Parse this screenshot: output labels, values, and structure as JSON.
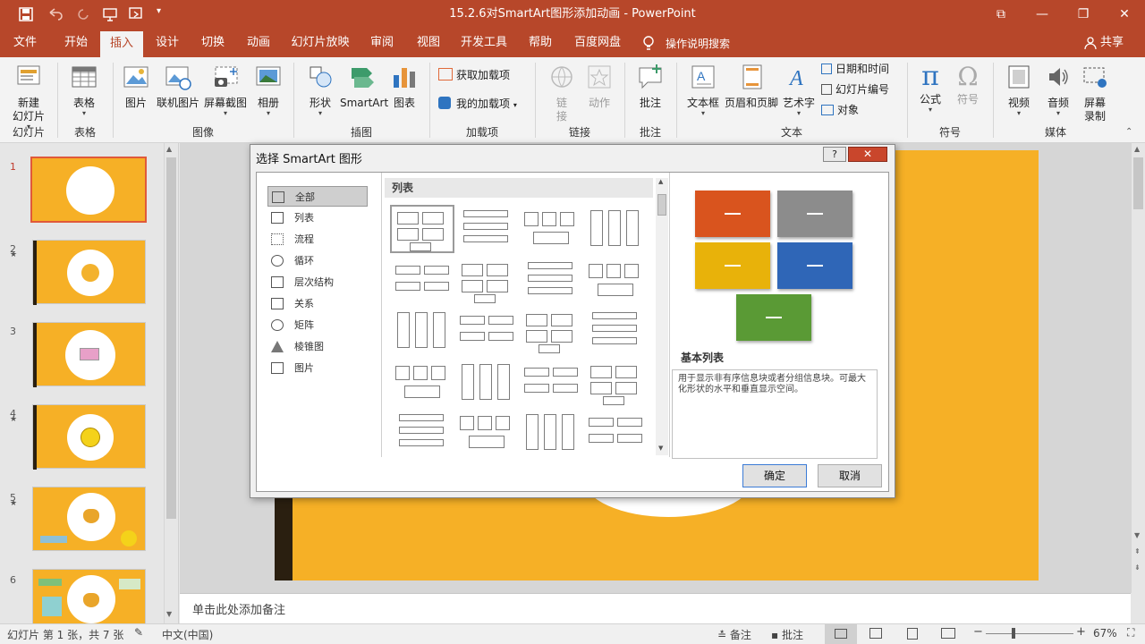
{
  "window": {
    "title": "15.2.6对SmartArt图形添加动画 - PowerPoint"
  },
  "tabs": [
    "文件",
    "开始",
    "插入",
    "设计",
    "切换",
    "动画",
    "幻灯片放映",
    "审阅",
    "视图",
    "开发工具",
    "帮助",
    "百度网盘"
  ],
  "active_tab": "插入",
  "tellme": "操作说明搜索",
  "share": "共享",
  "ribbon": {
    "new_slide": "新建\n幻灯片",
    "table": "表格",
    "picture": "图片",
    "online_picture": "联机图片",
    "screenshot": "屏幕截图",
    "album": "相册",
    "shapes": "形状",
    "smartart": "SmartArt",
    "chart": "图表",
    "get_addins": "获取加载项",
    "my_addins": "我的加载项",
    "link": "链\n接",
    "action": "动作",
    "comment": "批注",
    "textbox": "文本框",
    "header_footer": "页眉和页脚",
    "wordart": "艺术字",
    "datetime": "日期和时间",
    "slide_number": "幻灯片编号",
    "object": "对象",
    "equation": "公式",
    "symbol": "符号",
    "video": "视频",
    "audio": "音频",
    "screen_record": "屏幕\n录制",
    "groups": {
      "slides": "幻灯片",
      "tables": "表格",
      "images": "图像",
      "illustrations": "插图",
      "addins": "加载项",
      "links": "链接",
      "comments": "批注",
      "text": "文本",
      "symbols": "符号",
      "media": "媒体"
    }
  },
  "slides": {
    "numbers": [
      "1",
      "2",
      "3",
      "4",
      "5",
      "6"
    ],
    "selected": 1
  },
  "notes_placeholder": "单击此处添加备注",
  "status": {
    "slide_info": "幻灯片 第 1 张，共 7 张",
    "language": "中文(中国)",
    "notes": "备注",
    "comments": "批注",
    "zoom": "67%"
  },
  "dialog": {
    "title": "选择 SmartArt 图形",
    "help": "?",
    "categories": [
      "全部",
      "列表",
      "流程",
      "循环",
      "层次结构",
      "关系",
      "矩阵",
      "棱锥图",
      "图片"
    ],
    "selected_category": "全部",
    "gallery_header": "列表",
    "preview_title": "基本列表",
    "preview_desc": "用于显示非有序信息块或者分组信息块。可最大化形状的水平和垂直显示空间。",
    "ok": "确定",
    "cancel": "取消",
    "preview_colors": [
      "#d9541e",
      "#8c8c8c",
      "#e8b20a",
      "#2f66b7",
      "#5a9a35"
    ]
  }
}
